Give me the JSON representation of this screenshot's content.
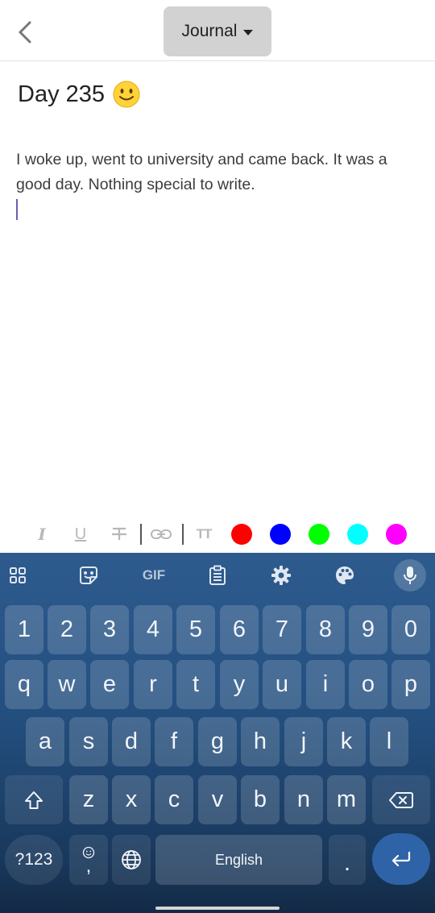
{
  "header": {
    "back_icon": "chevron-left-icon",
    "journal_label": "Journal",
    "dropdown_icon": "caret-down-icon"
  },
  "entry": {
    "title": "Day 235",
    "mood_icon": "slightly-smiling-face-icon",
    "body": "I woke up, went to university and came back. It was a good day. Nothing special to write."
  },
  "format_toolbar": {
    "italic_label": "I",
    "underline_label": "U",
    "strikethrough_label": "S",
    "link_icon": "link-icon",
    "text_size_label": "TT",
    "colors": [
      "#ff0000",
      "#0000ff",
      "#00ff00",
      "#00ffff",
      "#ff00ff"
    ]
  },
  "keyboard": {
    "toolbar_icons": [
      "apps-grid-icon",
      "sticker-icon",
      "gif-icon",
      "clipboard-icon",
      "settings-gear-icon",
      "palette-icon",
      "microphone-icon"
    ],
    "gif_label": "GIF",
    "number_row": [
      "1",
      "2",
      "3",
      "4",
      "5",
      "6",
      "7",
      "8",
      "9",
      "0"
    ],
    "row1": [
      "q",
      "w",
      "e",
      "r",
      "t",
      "y",
      "u",
      "i",
      "o",
      "p"
    ],
    "row2": [
      "a",
      "s",
      "d",
      "f",
      "g",
      "h",
      "j",
      "k",
      "l"
    ],
    "row3": [
      "z",
      "x",
      "c",
      "v",
      "b",
      "n",
      "m"
    ],
    "symbols_label": "?123",
    "comma_label": ",",
    "space_label": "English",
    "period_label": ".",
    "shift_icon": "shift-icon",
    "backspace_icon": "backspace-icon",
    "emoji_icon": "emoji-icon",
    "globe_icon": "globe-icon",
    "enter_icon": "enter-icon"
  }
}
